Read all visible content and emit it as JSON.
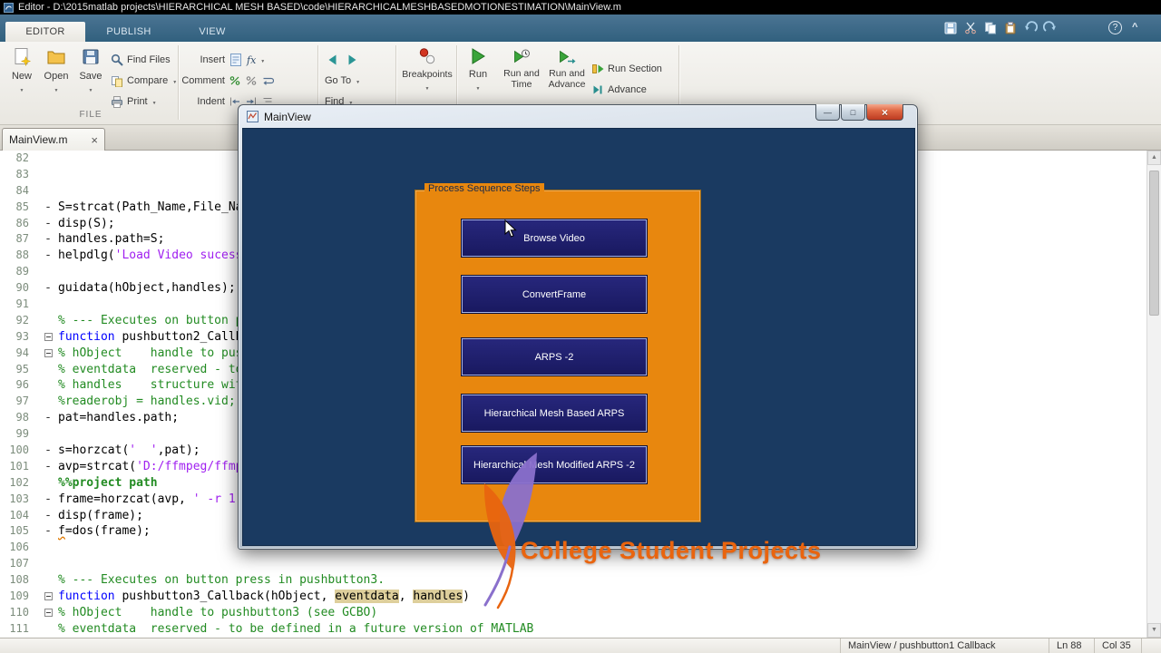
{
  "titlebar": {
    "title": "Editor - D:\\2015matlab projects\\HIERARCHICAL MESH BASED\\code\\HIERARCHICALMESHBASEDMOTIONESTIMATION\\MainView.m"
  },
  "ribbon": {
    "tabs": [
      "EDITOR",
      "PUBLISH",
      "VIEW"
    ],
    "help_glyph": "?",
    "collapse_glyph": "^",
    "file": {
      "group_label": "FILE",
      "new": "New",
      "open": "Open",
      "save": "Save",
      "find_files": "Find Files",
      "compare": "Compare",
      "print": "Print"
    },
    "edit": {
      "insert": "Insert",
      "comment": "Comment",
      "indent": "Indent",
      "fx": "fx"
    },
    "navigate": {
      "goto": "Go To",
      "find": "Find"
    },
    "breakpoints": {
      "label": "Breakpoints"
    },
    "run": {
      "run": "Run",
      "run_and": "Run and",
      "time": "Time",
      "advance": "Advance",
      "run_section": "Run Section"
    }
  },
  "doc_tab": {
    "label": "MainView.m",
    "close": "×"
  },
  "editor": {
    "lines": [
      {
        "n": "82",
        "m": "",
        "s": []
      },
      {
        "n": "83",
        "m": "",
        "s": []
      },
      {
        "n": "84",
        "m": "",
        "s": []
      },
      {
        "n": "85",
        "m": "-",
        "s": [
          {
            "t": "S=strcat(Path_Name,File_Na",
            "c": "pl"
          }
        ]
      },
      {
        "n": "86",
        "m": "-",
        "s": [
          {
            "t": "disp(S);",
            "c": "pl"
          }
        ]
      },
      {
        "n": "87",
        "m": "-",
        "s": [
          {
            "t": "handles.path=S;",
            "c": "pl"
          }
        ]
      },
      {
        "n": "88",
        "m": "-",
        "s": [
          {
            "t": "helpdlg(",
            "c": "pl"
          },
          {
            "t": "'Load Video sucess",
            "c": "st"
          }
        ]
      },
      {
        "n": "89",
        "m": "",
        "s": []
      },
      {
        "n": "90",
        "m": "-",
        "s": [
          {
            "t": "guidata(hObject,handles);",
            "c": "pl"
          }
        ]
      },
      {
        "n": "91",
        "m": "",
        "s": []
      },
      {
        "n": "92",
        "m": "",
        "s": [
          {
            "t": "% --- Executes on button p",
            "c": "cm"
          }
        ]
      },
      {
        "n": "93",
        "m": "f",
        "s": [
          {
            "t": "function ",
            "c": "kw"
          },
          {
            "t": "pushbutton2_Callb",
            "c": "pl"
          }
        ]
      },
      {
        "n": "94",
        "m": "f",
        "s": [
          {
            "t": "% hObject    handle to pus",
            "c": "cm"
          }
        ]
      },
      {
        "n": "95",
        "m": "",
        "s": [
          {
            "t": "% eventdata  reserved - to",
            "c": "cm"
          }
        ]
      },
      {
        "n": "96",
        "m": "",
        "s": [
          {
            "t": "% handles    structure wit",
            "c": "cm"
          }
        ]
      },
      {
        "n": "97",
        "m": "",
        "s": [
          {
            "t": "%readerobj = handles.vid;",
            "c": "cm"
          }
        ]
      },
      {
        "n": "98",
        "m": "-",
        "s": [
          {
            "t": "pat=handles.path;",
            "c": "pl"
          }
        ]
      },
      {
        "n": "99",
        "m": "",
        "s": []
      },
      {
        "n": "100",
        "m": "-",
        "s": [
          {
            "t": "s=horzcat(",
            "c": "pl"
          },
          {
            "t": "'  '",
            "c": "st"
          },
          {
            "t": ",pat);",
            "c": "pl"
          }
        ]
      },
      {
        "n": "101",
        "m": "-",
        "s": [
          {
            "t": "avp=strcat(",
            "c": "pl"
          },
          {
            "t": "'D:/ffmpeg/ffmp",
            "c": "st"
          }
        ]
      },
      {
        "n": "102",
        "m": "",
        "s": [
          {
            "t": "%%project path",
            "c": "cmb"
          }
        ]
      },
      {
        "n": "103",
        "m": "-",
        "s": [
          {
            "t": "frame=horzcat(avp, ",
            "c": "pl"
          },
          {
            "t": "' -r 1",
            "c": "st"
          }
        ]
      },
      {
        "n": "104",
        "m": "-",
        "s": [
          {
            "t": "disp(frame);",
            "c": "pl"
          }
        ]
      },
      {
        "n": "105",
        "m": "-",
        "s": [
          {
            "t": "f",
            "c": "wn"
          },
          {
            "t": "=dos(frame);",
            "c": "pl"
          }
        ]
      },
      {
        "n": "106",
        "m": "",
        "s": []
      },
      {
        "n": "107",
        "m": "",
        "s": []
      },
      {
        "n": "108",
        "m": "",
        "s": [
          {
            "t": "% --- Executes on button press in pushbutton3.",
            "c": "cm"
          }
        ]
      },
      {
        "n": "109",
        "m": "f",
        "s": [
          {
            "t": "function ",
            "c": "kw"
          },
          {
            "t": "pushbutton3_Callback(hObject, ",
            "c": "pl"
          },
          {
            "t": "eventdata",
            "c": "hl"
          },
          {
            "t": ", ",
            "c": "pl"
          },
          {
            "t": "handles",
            "c": "hl"
          },
          {
            "t": ")",
            "c": "pl"
          }
        ]
      },
      {
        "n": "110",
        "m": "f",
        "s": [
          {
            "t": "% hObject    handle to pushbutton3 (see GCBO)",
            "c": "cm"
          }
        ]
      },
      {
        "n": "111",
        "m": "",
        "s": [
          {
            "t": "% eventdata  reserved - to be defined in a future version of MATLAB",
            "c": "cm"
          }
        ]
      }
    ]
  },
  "dialog": {
    "title": "MainView",
    "controls": {
      "minimize": "—",
      "maximize": "□",
      "close": "×"
    },
    "panel_label": "Process Sequence Steps",
    "buttons": [
      "Browse Video",
      "ConvertFrame",
      "ARPS -2",
      "Hierarchical Mesh Based ARPS",
      "Hierarchical Mesh Modified ARPS -2"
    ]
  },
  "watermark": {
    "text": "College Student Projects"
  },
  "status": {
    "callback": "MainView / pushbutton1 Callback",
    "line": "Ln 88",
    "col": "Col 35"
  }
}
